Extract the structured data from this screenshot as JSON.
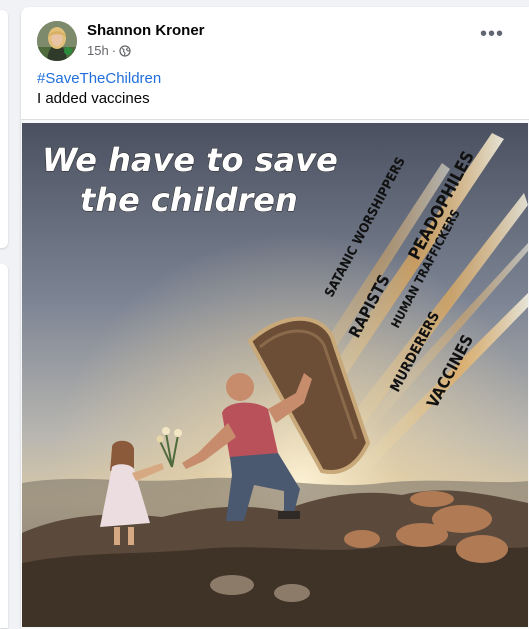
{
  "post": {
    "author": "Shannon Kroner",
    "time": "15h",
    "separator": "·",
    "visibility_icon": "globe-icon",
    "more_icon": "more-options-icon",
    "more_label": "•••",
    "hashtag": "#SaveTheChildren",
    "caption": "I added vaccines"
  },
  "image": {
    "headline_line1": "We have to save",
    "headline_line2": "the children",
    "meteor_labels": [
      "SATANIC WORSHIPPERS",
      "PEADOPHILES",
      "RAPISTS",
      "HUMAN TRAFFICKERS",
      "MURDERERS",
      "VACCINES"
    ]
  },
  "colors": {
    "link": "#216fdb",
    "text": "#050505",
    "secondary": "#65676b",
    "background": "#f0f2f5"
  }
}
